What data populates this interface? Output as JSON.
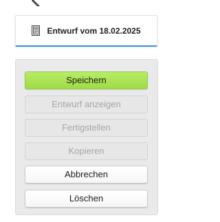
{
  "draft": {
    "title": "Entwurf vom 18.02.2025",
    "icon": "document-icon"
  },
  "actions": {
    "save_label": "Speichern",
    "show_draft_label": "Entwurf anzeigen",
    "finalize_label": "Fertigstellen",
    "copy_label": "Kopieren",
    "cancel_label": "Abbrechen",
    "delete_label": "Löschen"
  },
  "colors": {
    "primary_button": "#a8e052",
    "accent_underline": "#3d8ee3",
    "disabled_text": "#a6a6a6"
  }
}
